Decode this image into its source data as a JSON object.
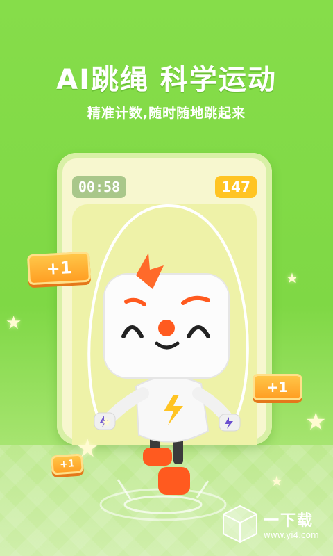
{
  "headline": "AI跳绳 科学运动",
  "subheadline": "精准计数,随时随地跳起来",
  "phone": {
    "timer": "00:58",
    "count": "147"
  },
  "badges": {
    "left": "+1",
    "right": "+1",
    "bottom": "+1"
  },
  "watermark": {
    "name": "一下载",
    "url": "www.yi4.com"
  },
  "icons": [
    "star-icon",
    "lightning-icon",
    "cube-logo-icon"
  ],
  "colors": {
    "background": "#7fd845",
    "timer_bg": "#a9c78a",
    "count_bg": "#ffc423",
    "badge": "#ff9b20",
    "accent": "#ff5a1f"
  }
}
